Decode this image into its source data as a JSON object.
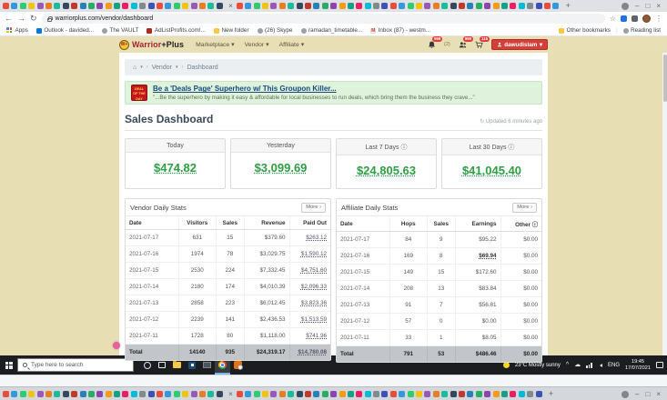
{
  "icons": {
    "home": "⌂",
    "caret": "▾",
    "chevron": "›",
    "refresh": "↻",
    "info": "ⓘ",
    "star": "☆",
    "kebab": "⋮",
    "back": "←",
    "forward": "→",
    "reload": "↻",
    "close": "×",
    "minimize": "–",
    "maximize": "□",
    "plus": "+"
  },
  "browser": {
    "url": "warriorplus.com/vendor/dashboard",
    "favicon_palette": [
      "#e74c3c",
      "#3498db",
      "#2ecc71",
      "#f1c40f",
      "#9b59b6",
      "#e67e22",
      "#1abc9c",
      "#34495e",
      "#c0392b",
      "#2980b9",
      "#27ae60",
      "#8e44ad",
      "#f39c12",
      "#16a085",
      "#e91e63",
      "#00bcd4",
      "#7f8c8d",
      "#3f51b5"
    ],
    "top_tabs": {
      "before": {
        "count": 26
      },
      "after": {
        "count": 38
      }
    },
    "bottom_tabs": {
      "before": {
        "count": 26
      },
      "after": {
        "count": 36
      }
    },
    "bookmarks": [
      "Apps",
      "Outlook - davided...",
      "The VAULT",
      "AdListProfits.com!...",
      "New folder",
      "(26) Skype",
      "ramadan_timetable...",
      "Inbox (87) - westm..."
    ],
    "other_bookmarks": "Other bookmarks",
    "reading_list": "Reading list",
    "gmail_letter": "M"
  },
  "site_header": {
    "logo_monogram": "W+",
    "logo_part1": "Warrior",
    "logo_part2": "+Plus",
    "nav": [
      "Marketplace",
      "Vendor",
      "Affiliate"
    ],
    "bell_badge": "999",
    "paren_count": "(2)",
    "chat_badge": "999",
    "cart_badge": "115",
    "username": "dawudislam"
  },
  "breadcrumb": {
    "vendor": "Vendor",
    "dashboard": "Dashboard"
  },
  "promo": {
    "badge_line1": "DEAL",
    "badge_line2": "OF THE",
    "badge_line3": "DAY",
    "title": "Be a 'Deals Page' Superhero w/ This Groupon Killer...",
    "quote": "\"...Be the superhero by making it easy & affordable for local businesses to run deals, which bring them the business they crave...\""
  },
  "page": {
    "title": "Sales Dashboard",
    "updated": "Updated 6 minutes ago"
  },
  "stats_cards": [
    {
      "label": "Today",
      "value": "$474.82"
    },
    {
      "label": "Yesterday",
      "value": "$3,099.69"
    },
    {
      "label": "Last 7 Days",
      "value": "$24,805.63"
    },
    {
      "label": "Last 30 Days",
      "value": "$41,045.40"
    }
  ],
  "vendor_table": {
    "title": "Vendor Daily Stats",
    "more_label": "More ›",
    "columns": [
      "Date",
      "Visitors",
      "Sales",
      "Revenue",
      "Paid Out"
    ],
    "rows": [
      [
        "2021-07-17",
        "631",
        "15",
        "$379.60",
        "$263.12"
      ],
      [
        "2021-07-16",
        "1974",
        "78",
        "$3,029.75",
        "$1,590.12"
      ],
      [
        "2021-07-15",
        "2530",
        "224",
        "$7,332.45",
        "$4,751.60"
      ],
      [
        "2021-07-14",
        "2180",
        "174",
        "$4,010.39",
        "$2,096.33"
      ],
      [
        "2021-07-13",
        "2858",
        "223",
        "$6,012.45",
        "$3,823.36"
      ],
      [
        "2021-07-12",
        "2239",
        "141",
        "$2,436.53",
        "$1,513.59"
      ],
      [
        "2021-07-11",
        "1728",
        "80",
        "$1,118.00",
        "$741.96"
      ]
    ],
    "total": [
      "Total",
      "14140",
      "935",
      "$24,319.17",
      "$14,780.08"
    ]
  },
  "affiliate_table": {
    "title": "Affiliate Daily Stats",
    "more_label": "More ›",
    "columns": [
      "Date",
      "Hops",
      "Sales",
      "Earnings",
      "Other"
    ],
    "rows": [
      [
        "2021-07-17",
        "84",
        "9",
        "$95.22",
        "$0.00"
      ],
      [
        "2021-07-16",
        "169",
        "8",
        "$69.94",
        "$0.00"
      ],
      [
        "2021-07-15",
        "149",
        "15",
        "$172.60",
        "$0.00"
      ],
      [
        "2021-07-14",
        "208",
        "13",
        "$83.84",
        "$0.00"
      ],
      [
        "2021-07-13",
        "91",
        "7",
        "$56.81",
        "$0.00"
      ],
      [
        "2021-07-12",
        "57",
        "0",
        "$0.00",
        "$0.00"
      ],
      [
        "2021-07-11",
        "33",
        "1",
        "$8.05",
        "$0.00"
      ]
    ],
    "total": [
      "Total",
      "791",
      "53",
      "$486.46",
      "$0.00"
    ]
  },
  "taskbar": {
    "search_placeholder": "Type here to search",
    "weather": "23°C Mostly sunny",
    "language": "ENG",
    "time": "19:45",
    "date": "17/07/2021"
  }
}
